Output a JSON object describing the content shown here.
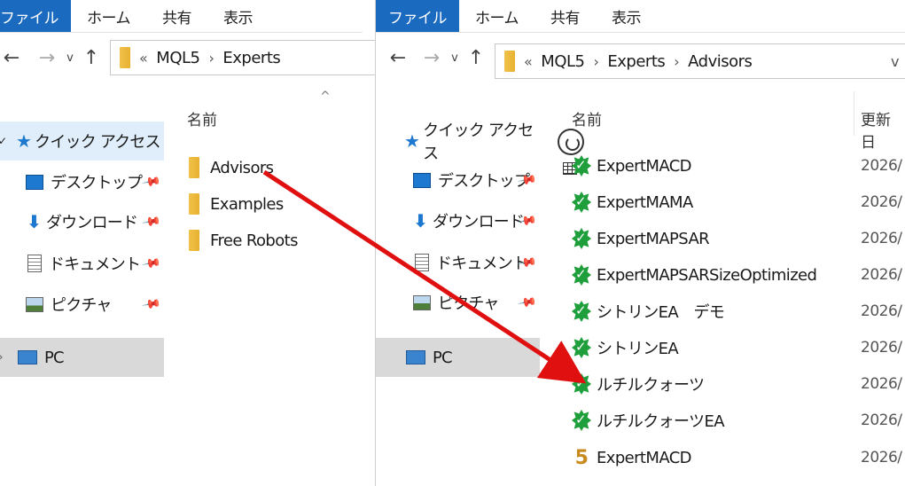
{
  "left": {
    "ribbon": {
      "file": "ファイル",
      "home": "ホーム",
      "share": "共有",
      "view": "表示"
    },
    "address": {
      "overflow": "«",
      "crumbs": [
        "MQL5",
        "Experts"
      ]
    },
    "sidebar": {
      "quick_access": "クイック アクセス",
      "items": [
        "デスクトップ",
        "ダウンロード",
        "ドキュメント",
        "ピクチャ"
      ],
      "pc": "PC"
    },
    "column_name": "名前",
    "sort_indicator": "^",
    "folders": [
      "Advisors",
      "Examples",
      "Free Robots"
    ]
  },
  "right": {
    "ribbon": {
      "file": "ファイル",
      "home": "ホーム",
      "share": "共有",
      "view": "表示"
    },
    "address": {
      "overflow": "«",
      "crumbs": [
        "MQL5",
        "Experts",
        "Advisors"
      ],
      "dropdown": "v"
    },
    "sidebar": {
      "quick_access": "クイック アクセス",
      "items": [
        "デスクトップ",
        "ダウンロード",
        "ドキュメント",
        "ピクチャ"
      ],
      "pc": "PC"
    },
    "column_name": "名前",
    "column_date": "更新日",
    "files": [
      {
        "name": "ExpertMACD",
        "date": "2026/",
        "icon": "ea-icon"
      },
      {
        "name": "ExpertMAMA",
        "date": "2026/",
        "icon": "ea-icon"
      },
      {
        "name": "ExpertMAPSAR",
        "date": "2026/",
        "icon": "ea-icon"
      },
      {
        "name": "ExpertMAPSARSizeOptimized",
        "date": "2026/",
        "icon": "ea-icon"
      },
      {
        "name": "シトリンEA　デモ",
        "date": "2026/",
        "icon": "ea-icon"
      },
      {
        "name": "シトリンEA",
        "date": "2026/",
        "icon": "ea-icon"
      },
      {
        "name": "ルチルクォーツ",
        "date": "2026/",
        "icon": "ea-icon"
      },
      {
        "name": "ルチルクォーツEA",
        "date": "2026/",
        "icon": "ea-icon"
      },
      {
        "name": "ExpertMACD",
        "date": "2026/",
        "icon": "mql5-source-icon"
      }
    ]
  },
  "colors": {
    "accent": "#1a6ac0",
    "arrow": "#e01010",
    "ea_green": "#1f9e3c",
    "selection": "#dfeefa"
  }
}
